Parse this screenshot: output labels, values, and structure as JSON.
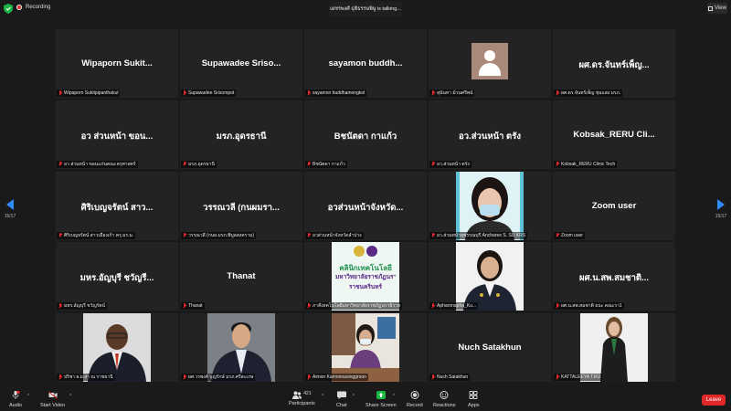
{
  "window": {
    "recording_label": "Recording",
    "talking_banner": "เผชรพงศ์ ธุติธรรษพิษู is talking...",
    "view_button": "View",
    "page_indicator_left": "15/17",
    "page_indicator_right": "15/17"
  },
  "participants": [
    {
      "display": "Wipaporn  Sukit...",
      "label": "Wipaporn Sukitpipanthakul",
      "type": "name"
    },
    {
      "display": "Supawadee  Sriso...",
      "label": "Supawadee Srisompot",
      "type": "name"
    },
    {
      "display": "sayamon  buddh...",
      "label": "sayamon buddhamongkol",
      "type": "name"
    },
    {
      "display": "",
      "label": "สุนันทา ม้วนศรีพน์",
      "type": "avatar"
    },
    {
      "display": "ผศ.ดร.จันทร์เพ็ญ...",
      "label": "ผศ.ดร.จันทร์เพ็ญ ชุมแสง มรภ.",
      "type": "name"
    },
    {
      "display": "อว ส่วนหน้า ขอน...",
      "label": "อว ส่วนหน้า ขอนแก่นคณะครุศาสตร์",
      "type": "name"
    },
    {
      "display": "มรภ.อุดรธานี",
      "label": "มรภ.อุดรธานี",
      "type": "name"
    },
    {
      "display": "Bชนัตดา กาแก้ว",
      "label": "Bชนัตดา กาแก้ว",
      "type": "name"
    },
    {
      "display": "อว.ส่วนหน้า ตรัง",
      "label": "อว.ส่วนหน้า ตรัง",
      "type": "name"
    },
    {
      "display": "Kobsak_RERU  Cli...",
      "label": "Kobsak_RERU Clinic Tech",
      "type": "name"
    },
    {
      "display": "ศิริเบญจรัตน์ สาว...",
      "label": "ศิริเบญจรัตน์ สาวเมืองเก้า ครุ.มร.ม.",
      "type": "name"
    },
    {
      "display": "วรรณวลี (กนผมรา...",
      "label": "วรรณวลี (กนผ.มรภ.พิบูลสงคราม)",
      "type": "name"
    },
    {
      "display": "อวส่วนหน้าจังหวัด...",
      "label": "อวส่วนหน้าจังหวัดลำปาง",
      "type": "name"
    },
    {
      "display": "",
      "label": "อว.ส่วนหน้าสุพรรณบุรี Ancharee S. SU KRS",
      "type": "photo_woman_mask"
    },
    {
      "display": "Zoom user",
      "label": "Zoom user",
      "type": "name"
    },
    {
      "display": "มหร.อัญบุรี ชวัญรี...",
      "label": "มหร.อัญบุรี ชวัญรัตน์",
      "type": "name"
    },
    {
      "display": "Thanat",
      "label": "Thanat",
      "type": "name"
    },
    {
      "display": "",
      "label": "ภาคีเทคโนโลยีมหาวิทยาลัยราชภัฏนราธิวาส",
      "type": "logo_clinic",
      "logo_line1": "คลินิกเทคโนโลยี",
      "logo_line2": "มหาวิทยาลัยราชภัฏนราธิวาส",
      "logo_line3": "ราชนครินทร์"
    },
    {
      "display": "",
      "label": "Apharnnapha_Ku...",
      "type": "photo_woman_uniform"
    },
    {
      "display": "ผศ.น.สพ.สมชาติ...",
      "label": "ผศ.น.สพ.สมชาติ ธนะ คณะรา1",
      "type": "name"
    },
    {
      "display": "",
      "label": "ปริชา ผ.ผ.สา ณ ราชธานี",
      "type": "photo_man_glasses"
    },
    {
      "display": "",
      "label": "ผศ.วรพงศ์ บุญรักษ์ มรภ.ศรีสะเกษ",
      "type": "photo_man_suit"
    },
    {
      "display": "",
      "label": "Aimon Kamonnasinggroon",
      "type": "photo_woman_desk"
    },
    {
      "display": "Nuch Satakhun",
      "label": "Nuch Satakhun",
      "type": "name"
    },
    {
      "display": "",
      "label": "KATTALEEYA T.RU",
      "type": "photo_woman_standing"
    }
  ],
  "toolbar": {
    "audio": "Audio",
    "start_video": "Start Video",
    "participants": "Participants",
    "participants_count": "421",
    "chat": "Chat",
    "share_screen": "Share Screen",
    "record": "Record",
    "reactions": "Reactions",
    "apps": "Apps",
    "leave": "Leave"
  },
  "colors": {
    "accent": "#2d8cff",
    "share_green": "#19b543",
    "leave_red": "#e02828",
    "tile_bg": "#232323"
  }
}
